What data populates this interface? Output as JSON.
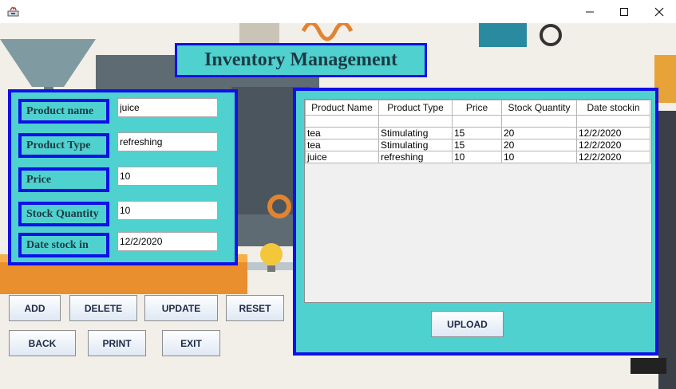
{
  "window": {
    "icon": "java-app-icon"
  },
  "header": {
    "title": "Inventory Management"
  },
  "form": {
    "fields": [
      {
        "label": "Product name",
        "value": "juice"
      },
      {
        "label": "Product Type",
        "value": "refreshing"
      },
      {
        "label": "Price",
        "value": "10"
      },
      {
        "label": "Stock Quantity",
        "value": "10"
      },
      {
        "label": "Date stock in",
        "value": "12/2/2020"
      }
    ]
  },
  "table": {
    "columns": [
      "Product Name",
      "Product Type",
      "Price",
      "Stock Quantity",
      "Date stockin"
    ],
    "rows": [
      [
        "tea",
        "Stimulating",
        "15",
        "20",
        "12/2/2020"
      ],
      [
        "tea",
        "Stimulating",
        "15",
        "20",
        "12/2/2020"
      ],
      [
        "juice",
        "refreshing",
        "10",
        "10",
        "12/2/2020"
      ]
    ]
  },
  "buttons": {
    "add": "ADD",
    "delete": "DELETE",
    "update": "UPDATE",
    "reset": "RESET",
    "back": "BACK",
    "print": "PRINT",
    "exit": "EXIT",
    "upload": "UPLOAD"
  },
  "colors": {
    "panel": "#4fd1cf",
    "border": "#1010e8"
  }
}
